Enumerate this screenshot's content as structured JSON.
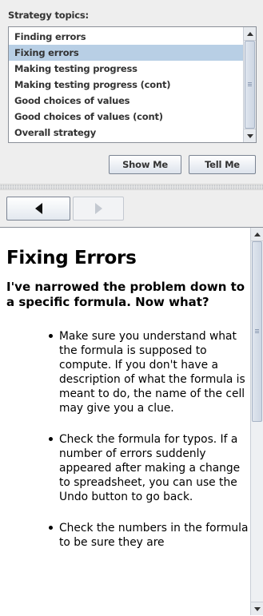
{
  "topics_panel": {
    "title": "Strategy topics:",
    "items": [
      {
        "label": "Finding errors",
        "selected": false
      },
      {
        "label": "Fixing errors",
        "selected": true
      },
      {
        "label": "Making testing progress",
        "selected": false
      },
      {
        "label": "Making testing progress (cont)",
        "selected": false
      },
      {
        "label": "Good choices of values",
        "selected": false
      },
      {
        "label": "Good choices of values (cont)",
        "selected": false
      },
      {
        "label": "Overall strategy",
        "selected": false
      }
    ],
    "show_me_label": "Show Me",
    "tell_me_label": "Tell Me"
  },
  "navigation": {
    "back_icon": "back-arrow-icon",
    "forward_icon": "forward-arrow-icon",
    "forward_enabled": false
  },
  "content": {
    "title": "Fixing Errors",
    "question": "I've narrowed the problem down to a specific formula. Now what?",
    "bullets": [
      "Make sure you understand what the formula is supposed to compute. If you don't have a description of what the formula is meant to do, the name of the cell may give you a clue.",
      "Check the formula for typos. If a number of errors suddenly appeared after making a change to spreadsheet, you can use the Undo button to go back.",
      "Check the numbers in the formula to be sure they are"
    ]
  },
  "colors": {
    "selection": "#b8cfe5",
    "panel_background": "#eeeeee",
    "content_background": "#ffffff",
    "text": "#333333"
  }
}
